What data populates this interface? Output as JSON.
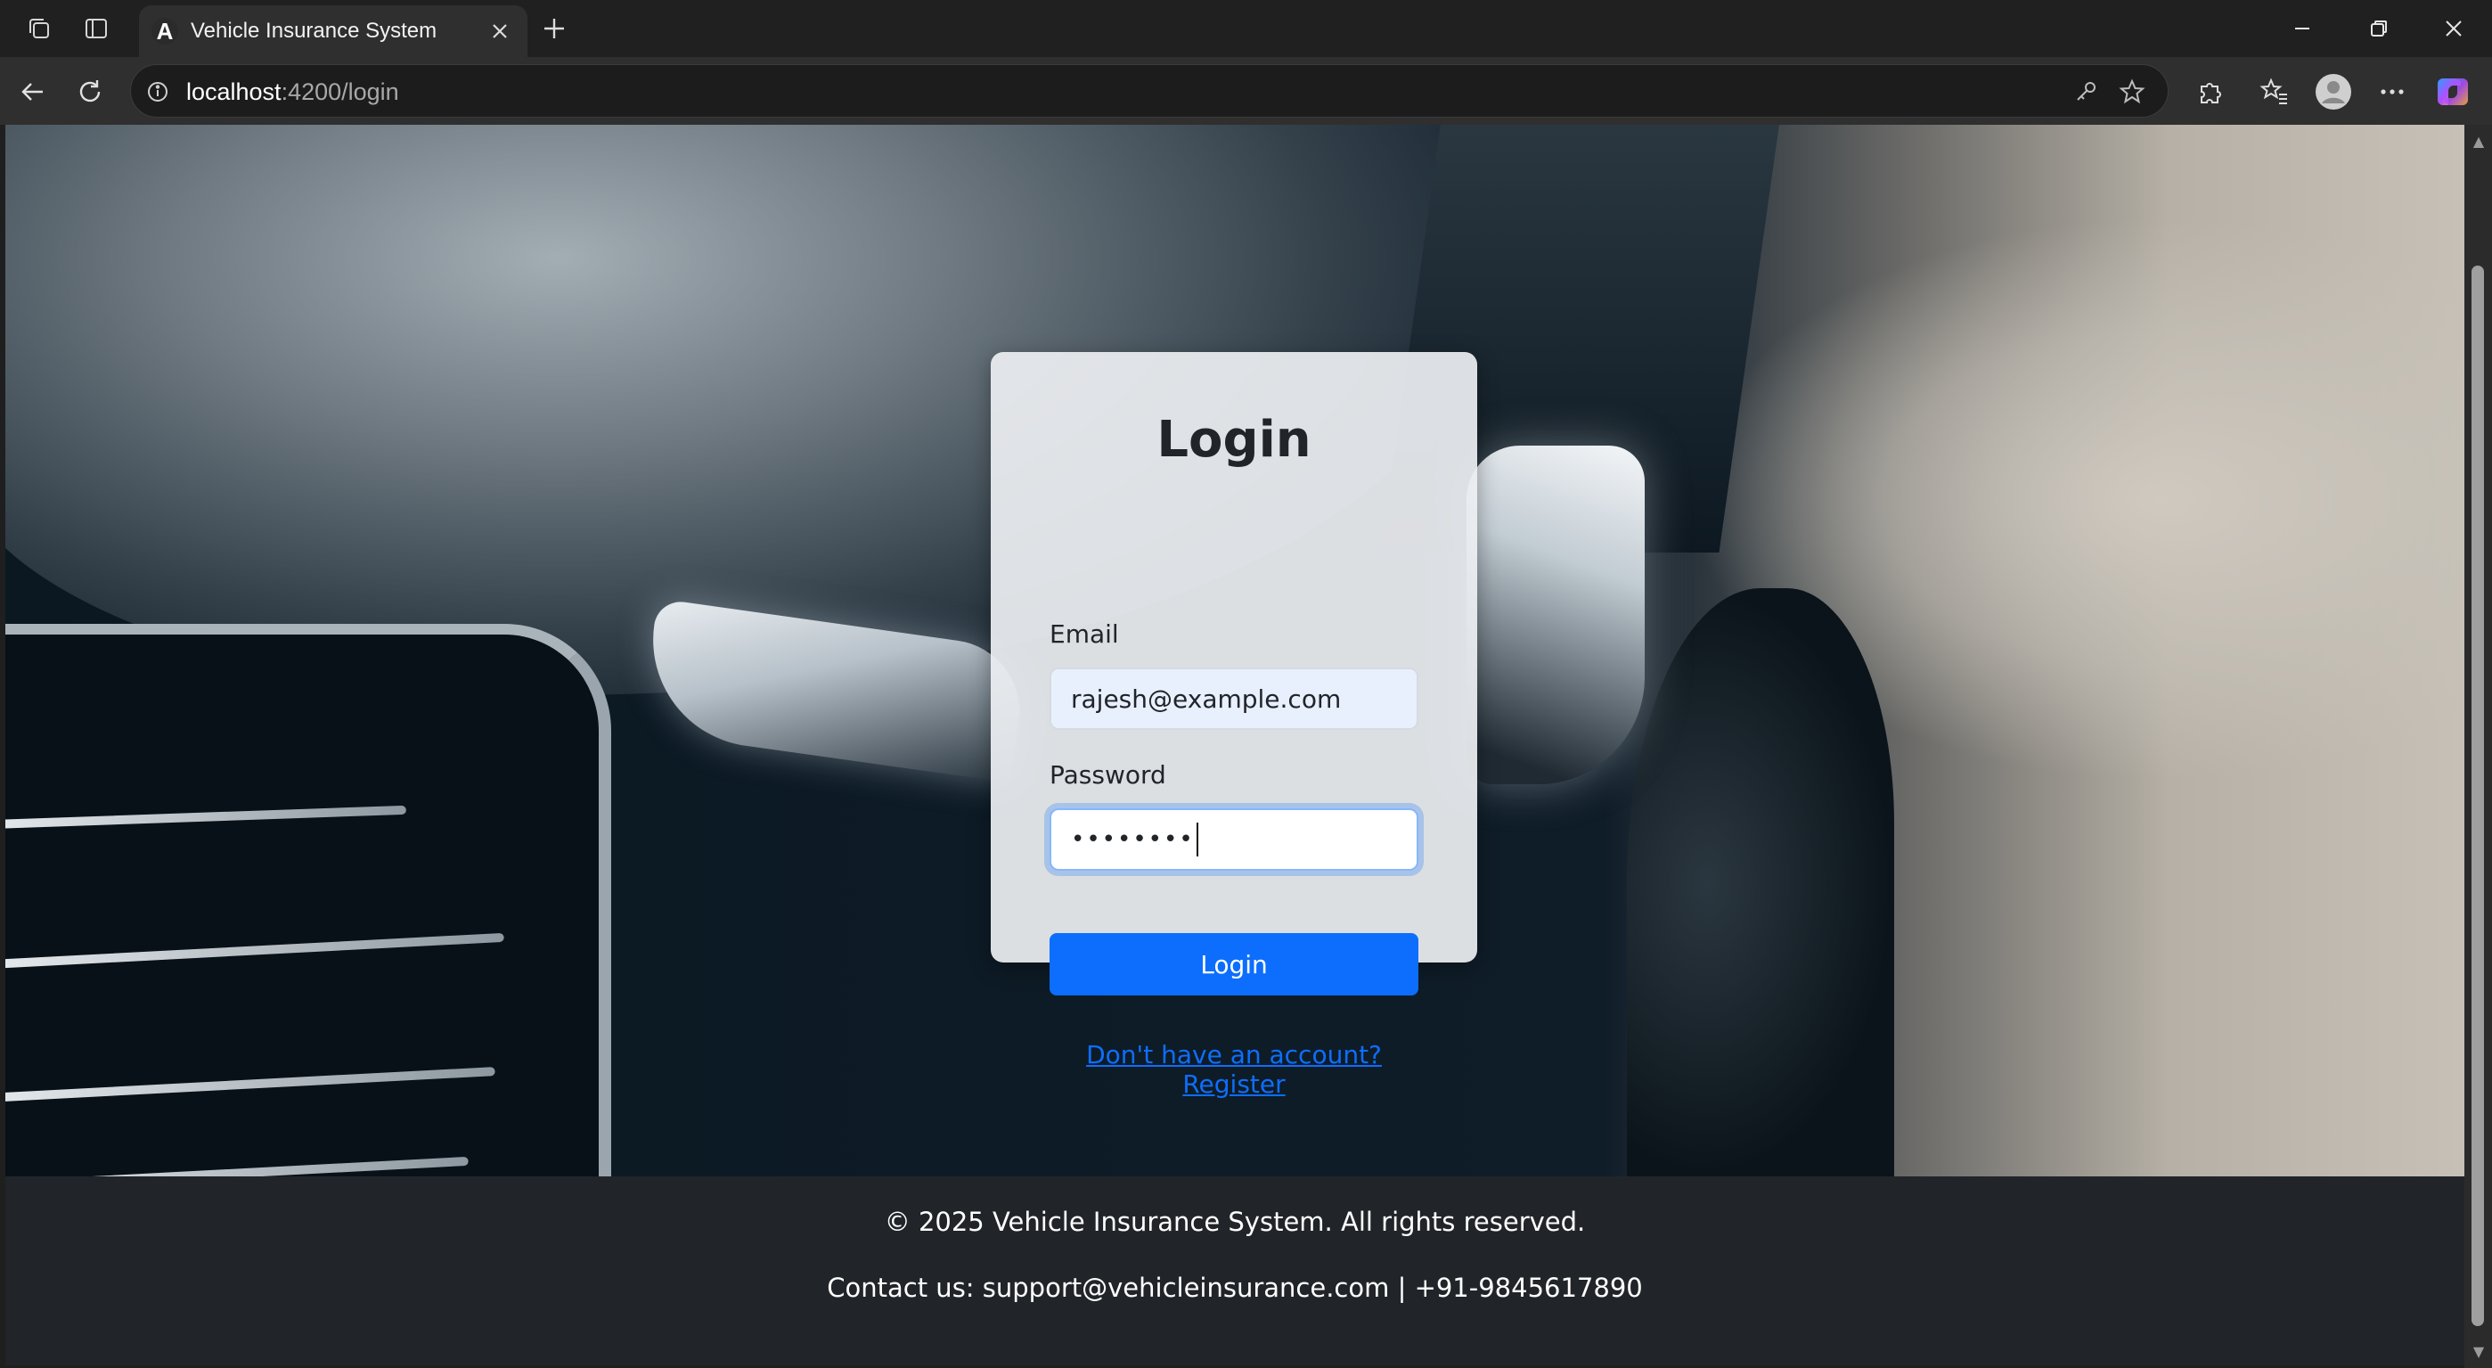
{
  "browser": {
    "tab_title": "Vehicle Insurance System",
    "tab_favicon": "A",
    "url_host": "localhost",
    "url_path": ":4200/login"
  },
  "icons": {
    "workspaces": "workspaces-icon",
    "tab_actions": "tab-actions-icon",
    "close_tab": "close-icon",
    "new_tab": "plus-icon",
    "back": "back-arrow-icon",
    "refresh": "refresh-icon",
    "site_info": "info-icon",
    "password_key": "key-icon",
    "favorite": "star-icon",
    "extensions": "puzzle-icon",
    "favorites": "favorites-icon",
    "profile": "profile-icon",
    "more": "more-icon",
    "copilot": "copilot-icon"
  },
  "login": {
    "title": "Login",
    "email_label": "Email",
    "email_value": "rajesh@example.com",
    "password_label": "Password",
    "password_value": "••••••••",
    "button_label": "Login",
    "register_link": "Don't have an account? Register"
  },
  "footer": {
    "copyright": "© 2025 Vehicle Insurance System. All rights reserved.",
    "contact": "Contact us: support@vehicleinsurance.com | +91-9845617890"
  },
  "colors": {
    "primary": "#0d6efd",
    "footer_bg": "#212529",
    "chrome_bg": "#202020",
    "toolbar_bg": "#2f2f2f"
  }
}
